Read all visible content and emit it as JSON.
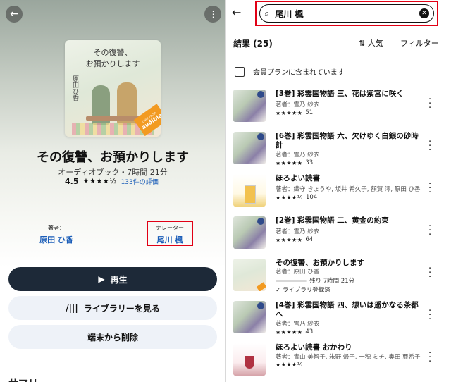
{
  "left_panel": {
    "cover": {
      "title_line1": "その復讐、",
      "title_line2": "お預かりします",
      "author": "原田ひ香",
      "badge_small": "ONLY FROM",
      "badge_big": "audible"
    },
    "title": "その復讐、お預かりします",
    "meta": "オーディオブック・7時間 21分",
    "rating_value": "4.5",
    "rating_stars": "★★★★½",
    "rating_count": "133件の評価",
    "author_label": "著者：",
    "author_name": "原田 ひ香",
    "narrator_label": "ナレーター",
    "narrator_name": "尾川 楓",
    "play_label": "再生",
    "library_label": "ライブラリーを見る",
    "remove_label": "端末から削除",
    "summary_heading": "サマリー"
  },
  "right_panel": {
    "search": {
      "value": "尾川 楓"
    },
    "results_label": "結果 (25)",
    "sort_label": "人気",
    "filter_label": "フィルター",
    "member_filter_label": "会員プランに含まれています",
    "results": [
      {
        "title": "[3巻] 彩雲国物語 三、花は紫宮に咲く",
        "author": "著者：雪乃 紗衣",
        "stars": "★★★★★",
        "count": "51"
      },
      {
        "title": "[6巻] 彩雲国物語 六、欠けゆく白銀の砂時計",
        "author": "著者：雪乃 紗衣",
        "stars": "★★★★★",
        "count": "33"
      },
      {
        "title": "ほろよい読書",
        "author": "著者：織守 きょうや, 坂井 希久子, 額賀 澪, 原田 ひ香",
        "stars": "★★★★½",
        "count": "104"
      },
      {
        "title": "[2巻] 彩雲国物語 二、黄金の約束",
        "author": "著者：雪乃 紗衣",
        "stars": "★★★★★",
        "count": "64"
      },
      {
        "title": "その復讐、お預かりします",
        "author": "著者：原田 ひ香",
        "progress_label": "残り 7時間 21分",
        "progress_fraction": 0.03,
        "library_status": "ライブラリ登録済"
      },
      {
        "title": "[4巻] 彩雲国物語 四、想いは遥かなる茶都へ",
        "author": "著者：雪乃 紗衣",
        "stars": "★★★★★",
        "count": "43"
      },
      {
        "title": "ほろよい読書 おかわり",
        "author": "著者：青山 美智子, 朱野 帰子, 一穂 ミチ, 奥田 亜希子",
        "stars": "★★★★½",
        "count": ""
      }
    ]
  },
  "colors": {
    "highlight_red": "#e10015",
    "link_blue": "#1a5db8",
    "play_button": "#1d2938",
    "badge_orange": "#f29a21"
  }
}
